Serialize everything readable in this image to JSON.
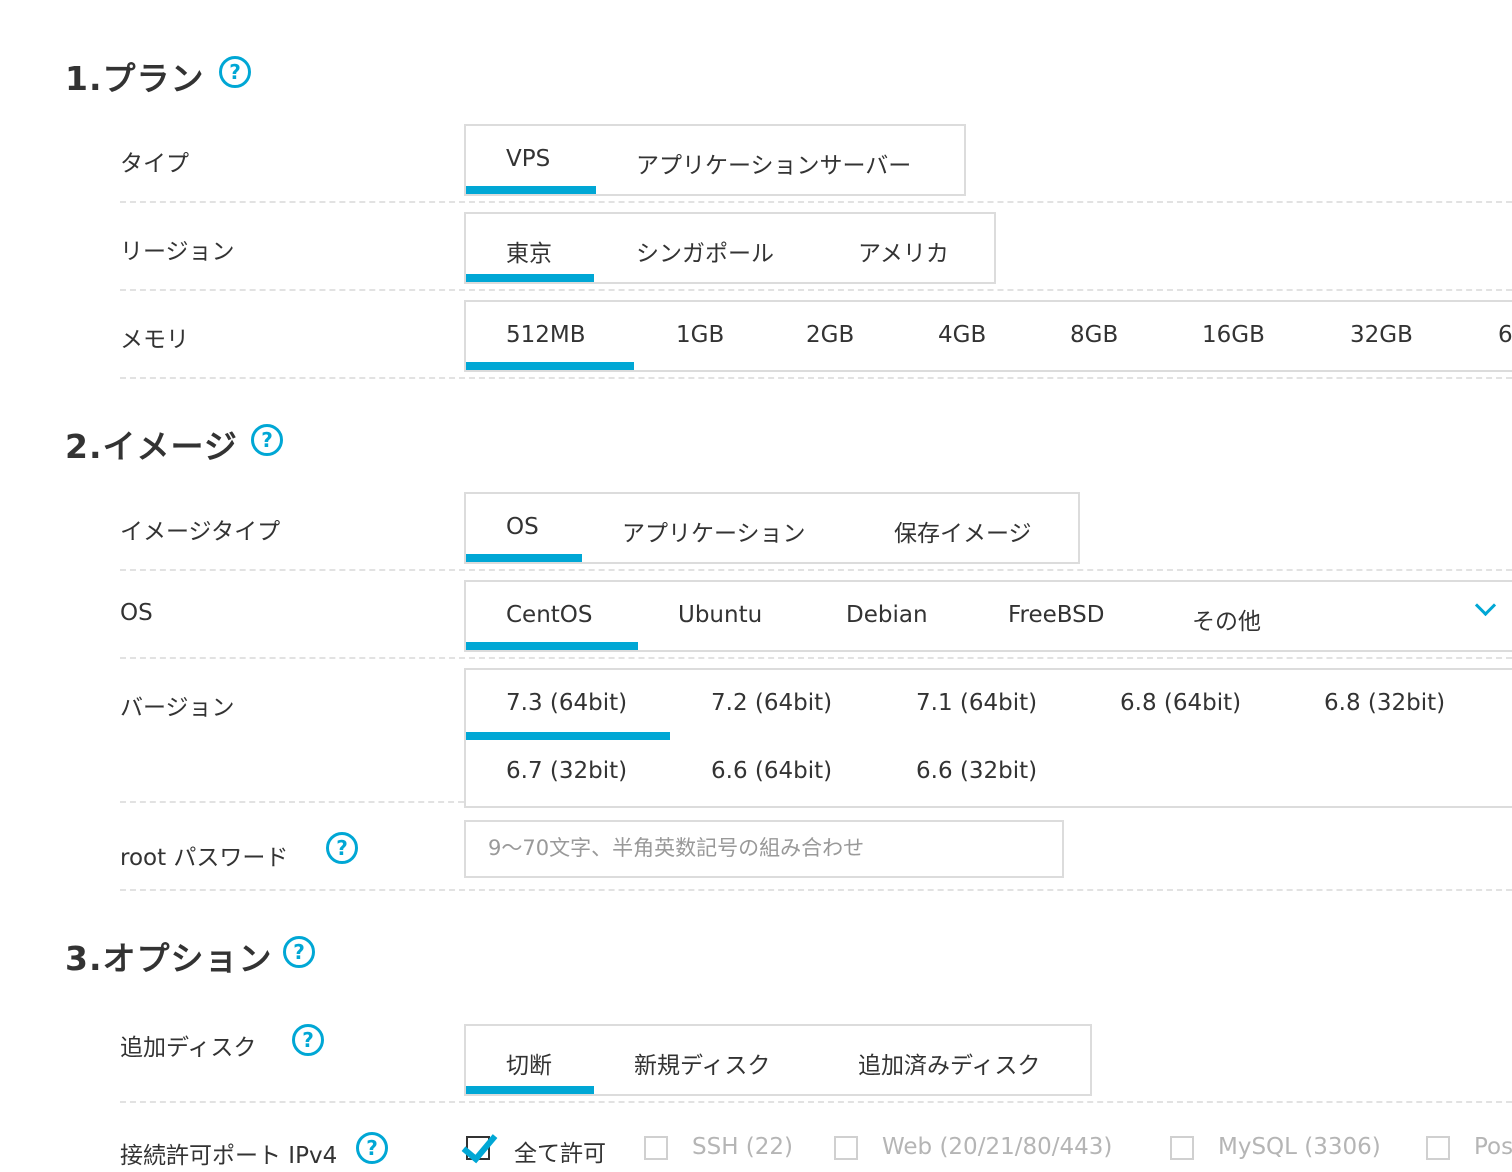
{
  "sections": {
    "plan": "1.プラン",
    "image": "2.イメージ",
    "options": "3.オプション"
  },
  "help_symbol": "?",
  "plan": {
    "type": {
      "label": "タイプ",
      "options": [
        "VPS",
        "アプリケーションサーバー"
      ],
      "selected": "VPS"
    },
    "region": {
      "label": "リージョン",
      "options": [
        "東京",
        "シンガポール",
        "アメリカ"
      ],
      "selected": "東京"
    },
    "memory": {
      "label": "メモリ",
      "options": [
        "512MB",
        "1GB",
        "2GB",
        "4GB",
        "8GB",
        "16GB",
        "32GB",
        "6"
      ],
      "selected": "512MB"
    }
  },
  "image": {
    "image_type": {
      "label": "イメージタイプ",
      "options": [
        "OS",
        "アプリケーション",
        "保存イメージ"
      ],
      "selected": "OS"
    },
    "os": {
      "label": "OS",
      "options": [
        "CentOS",
        "Ubuntu",
        "Debian",
        "FreeBSD",
        "その他"
      ],
      "selected": "CentOS"
    },
    "version": {
      "label": "バージョン",
      "options": [
        "7.3 (64bit)",
        "7.2 (64bit)",
        "7.1 (64bit)",
        "6.8 (64bit)",
        "6.8 (32bit)",
        "6.7 (32bit)",
        "6.6 (64bit)",
        "6.6 (32bit)"
      ],
      "selected": "7.3 (64bit)"
    },
    "root_password": {
      "label": "root パスワード",
      "placeholder": "9〜70文字、半角英数記号の組み合わせ",
      "value": ""
    }
  },
  "options": {
    "disk": {
      "label": "追加ディスク",
      "options": [
        "切断",
        "新規ディスク",
        "追加済みディスク"
      ],
      "selected": "切断"
    },
    "ports": {
      "label": "接続許可ポート IPv4",
      "items": [
        {
          "label": "全て許可",
          "checked": true
        },
        {
          "label": "SSH (22)",
          "checked": false
        },
        {
          "label": "Web (20/21/80/443)",
          "checked": false
        },
        {
          "label": "MySQL (3306)",
          "checked": false
        },
        {
          "label": "Pos",
          "checked": false
        }
      ]
    }
  },
  "colors": {
    "accent": "#00a7d5",
    "text": "#333333",
    "border": "#dcdcdc",
    "disabled": "#b5b5b5"
  }
}
